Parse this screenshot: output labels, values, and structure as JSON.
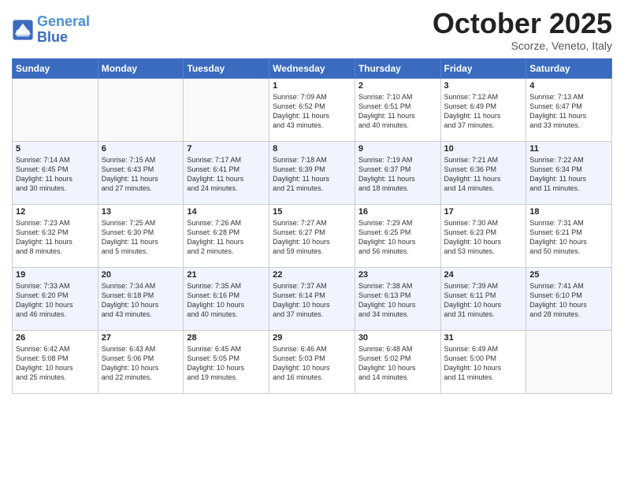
{
  "header": {
    "logo_line1": "General",
    "logo_line2": "Blue",
    "month": "October 2025",
    "location": "Scorze, Veneto, Italy"
  },
  "weekdays": [
    "Sunday",
    "Monday",
    "Tuesday",
    "Wednesday",
    "Thursday",
    "Friday",
    "Saturday"
  ],
  "weeks": [
    [
      {
        "day": "",
        "info": ""
      },
      {
        "day": "",
        "info": ""
      },
      {
        "day": "",
        "info": ""
      },
      {
        "day": "1",
        "info": "Sunrise: 7:09 AM\nSunset: 6:52 PM\nDaylight: 11 hours\nand 43 minutes."
      },
      {
        "day": "2",
        "info": "Sunrise: 7:10 AM\nSunset: 6:51 PM\nDaylight: 11 hours\nand 40 minutes."
      },
      {
        "day": "3",
        "info": "Sunrise: 7:12 AM\nSunset: 6:49 PM\nDaylight: 11 hours\nand 37 minutes."
      },
      {
        "day": "4",
        "info": "Sunrise: 7:13 AM\nSunset: 6:47 PM\nDaylight: 11 hours\nand 33 minutes."
      }
    ],
    [
      {
        "day": "5",
        "info": "Sunrise: 7:14 AM\nSunset: 6:45 PM\nDaylight: 11 hours\nand 30 minutes."
      },
      {
        "day": "6",
        "info": "Sunrise: 7:15 AM\nSunset: 6:43 PM\nDaylight: 11 hours\nand 27 minutes."
      },
      {
        "day": "7",
        "info": "Sunrise: 7:17 AM\nSunset: 6:41 PM\nDaylight: 11 hours\nand 24 minutes."
      },
      {
        "day": "8",
        "info": "Sunrise: 7:18 AM\nSunset: 6:39 PM\nDaylight: 11 hours\nand 21 minutes."
      },
      {
        "day": "9",
        "info": "Sunrise: 7:19 AM\nSunset: 6:37 PM\nDaylight: 11 hours\nand 18 minutes."
      },
      {
        "day": "10",
        "info": "Sunrise: 7:21 AM\nSunset: 6:36 PM\nDaylight: 11 hours\nand 14 minutes."
      },
      {
        "day": "11",
        "info": "Sunrise: 7:22 AM\nSunset: 6:34 PM\nDaylight: 11 hours\nand 11 minutes."
      }
    ],
    [
      {
        "day": "12",
        "info": "Sunrise: 7:23 AM\nSunset: 6:32 PM\nDaylight: 11 hours\nand 8 minutes."
      },
      {
        "day": "13",
        "info": "Sunrise: 7:25 AM\nSunset: 6:30 PM\nDaylight: 11 hours\nand 5 minutes."
      },
      {
        "day": "14",
        "info": "Sunrise: 7:26 AM\nSunset: 6:28 PM\nDaylight: 11 hours\nand 2 minutes."
      },
      {
        "day": "15",
        "info": "Sunrise: 7:27 AM\nSunset: 6:27 PM\nDaylight: 10 hours\nand 59 minutes."
      },
      {
        "day": "16",
        "info": "Sunrise: 7:29 AM\nSunset: 6:25 PM\nDaylight: 10 hours\nand 56 minutes."
      },
      {
        "day": "17",
        "info": "Sunrise: 7:30 AM\nSunset: 6:23 PM\nDaylight: 10 hours\nand 53 minutes."
      },
      {
        "day": "18",
        "info": "Sunrise: 7:31 AM\nSunset: 6:21 PM\nDaylight: 10 hours\nand 50 minutes."
      }
    ],
    [
      {
        "day": "19",
        "info": "Sunrise: 7:33 AM\nSunset: 6:20 PM\nDaylight: 10 hours\nand 46 minutes."
      },
      {
        "day": "20",
        "info": "Sunrise: 7:34 AM\nSunset: 6:18 PM\nDaylight: 10 hours\nand 43 minutes."
      },
      {
        "day": "21",
        "info": "Sunrise: 7:35 AM\nSunset: 6:16 PM\nDaylight: 10 hours\nand 40 minutes."
      },
      {
        "day": "22",
        "info": "Sunrise: 7:37 AM\nSunset: 6:14 PM\nDaylight: 10 hours\nand 37 minutes."
      },
      {
        "day": "23",
        "info": "Sunrise: 7:38 AM\nSunset: 6:13 PM\nDaylight: 10 hours\nand 34 minutes."
      },
      {
        "day": "24",
        "info": "Sunrise: 7:39 AM\nSunset: 6:11 PM\nDaylight: 10 hours\nand 31 minutes."
      },
      {
        "day": "25",
        "info": "Sunrise: 7:41 AM\nSunset: 6:10 PM\nDaylight: 10 hours\nand 28 minutes."
      }
    ],
    [
      {
        "day": "26",
        "info": "Sunrise: 6:42 AM\nSunset: 5:08 PM\nDaylight: 10 hours\nand 25 minutes."
      },
      {
        "day": "27",
        "info": "Sunrise: 6:43 AM\nSunset: 5:06 PM\nDaylight: 10 hours\nand 22 minutes."
      },
      {
        "day": "28",
        "info": "Sunrise: 6:45 AM\nSunset: 5:05 PM\nDaylight: 10 hours\nand 19 minutes."
      },
      {
        "day": "29",
        "info": "Sunrise: 6:46 AM\nSunset: 5:03 PM\nDaylight: 10 hours\nand 16 minutes."
      },
      {
        "day": "30",
        "info": "Sunrise: 6:48 AM\nSunset: 5:02 PM\nDaylight: 10 hours\nand 14 minutes."
      },
      {
        "day": "31",
        "info": "Sunrise: 6:49 AM\nSunset: 5:00 PM\nDaylight: 10 hours\nand 11 minutes."
      },
      {
        "day": "",
        "info": ""
      }
    ]
  ]
}
